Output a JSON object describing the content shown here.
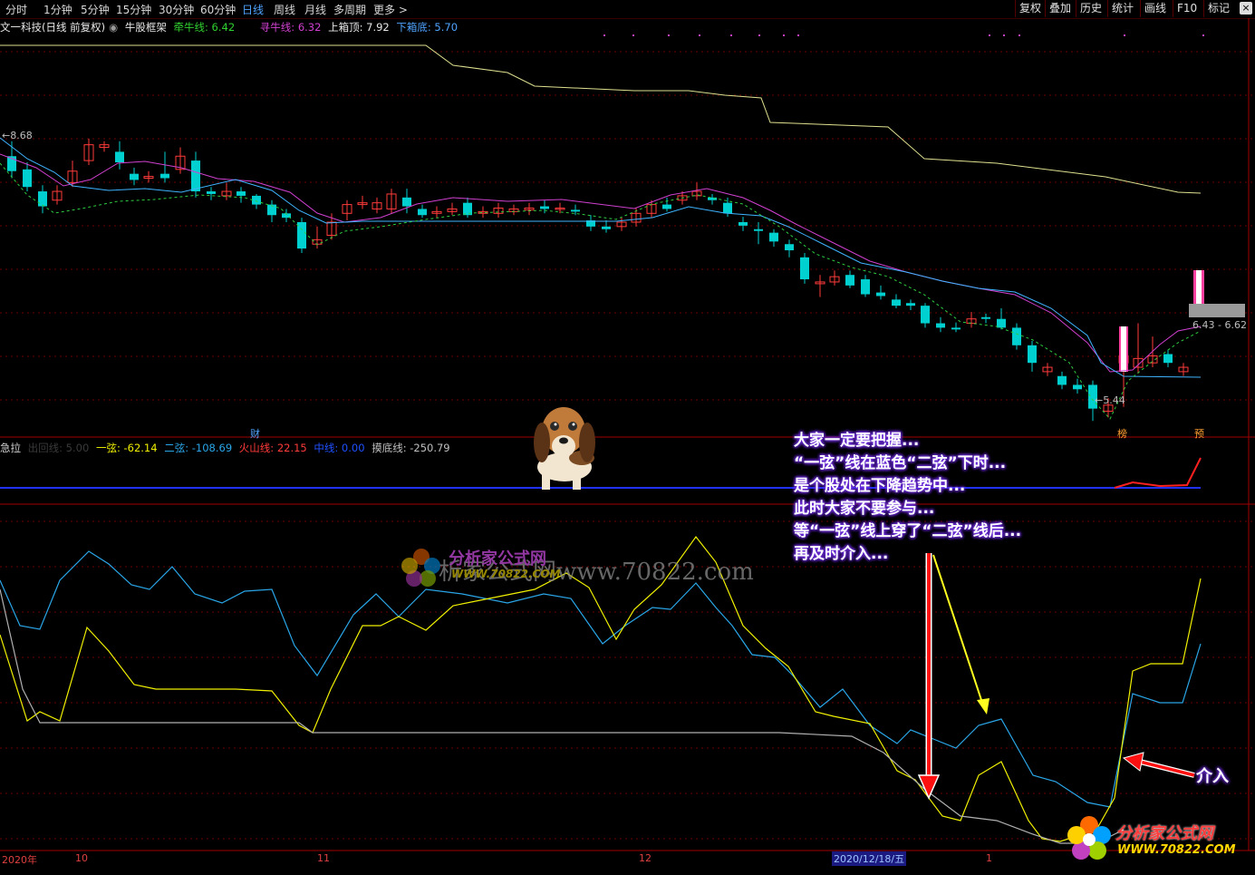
{
  "toolbar": {
    "periods": [
      "分时",
      "1分钟",
      "5分钟",
      "15分钟",
      "30分钟",
      "60分钟",
      "日线",
      "周线",
      "月线",
      "多周期",
      "更多 >"
    ],
    "active_period": "日线",
    "tools": [
      "复权",
      "叠加",
      "历史",
      "统计",
      "画线",
      "F10",
      "标记"
    ],
    "close": "×"
  },
  "legend_main": {
    "stock": "文一科技(日线 前复权)",
    "indicator": "牛股框架",
    "qianniu": "牵牛线: 6.42",
    "xunniu": "寻牛线: 6.32",
    "shangxiang": "上箱顶: 7.92",
    "xiaxiang": "下箱底: 5.70"
  },
  "legend_sub": {
    "name": "急拉",
    "faint": "出回线: 5.00",
    "yixian": "一弦: -62.14",
    "erxian": "二弦: -108.69",
    "huoshan": "火山线: 22.15",
    "zhong": "中线: 0.00",
    "modi": "摸底线: -250.79"
  },
  "price_labels": {
    "high": "8.68",
    "low": "5.44",
    "last": "6.43 - 6.62"
  },
  "markers": {
    "cai": "财",
    "bang": "榜",
    "yu": "预"
  },
  "annotation_lines": [
    "大家一定要把握...",
    "“一弦”线在蓝色“二弦”下时...",
    "是个股处在下降趋势中...",
    "此时大家不要参与...",
    "等“一弦”线上穿了“二弦”线后...",
    "再及时介入..."
  ],
  "entry_label": "介入",
  "dates": {
    "year": "2020年",
    "oct": "10",
    "nov": "11",
    "dec": "12",
    "cursor": "2020/12/18/五",
    "jan": "1"
  },
  "logo": {
    "name": "分析家公式网",
    "url": "WWW.70822.COM"
  },
  "watermark": {
    "name": "分析家公式网",
    "url": "WWW.70822.COM",
    "text": "析家公式网www.70822.com"
  },
  "colors": {
    "up": "#ff3b3b",
    "down": "#00d0d0",
    "yixian": "#f0f000",
    "erxian": "#2aa6e8",
    "qianniu": "#d040d0",
    "box": "#e0e090"
  }
}
